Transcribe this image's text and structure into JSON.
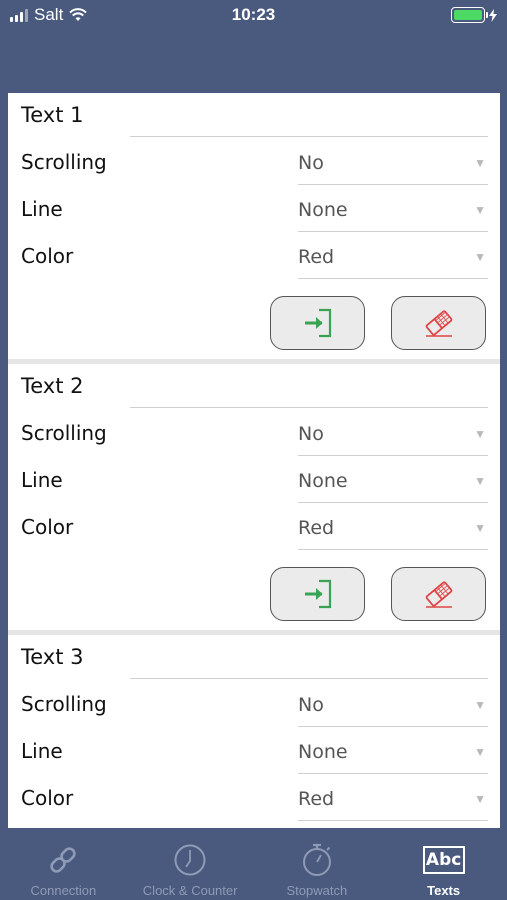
{
  "status": {
    "carrier": "Salt",
    "time": "10:23",
    "battery_color": "#4cd964"
  },
  "cards": [
    {
      "title": "Text 1",
      "rows": [
        {
          "label": "Scrolling",
          "value": "No"
        },
        {
          "label": "Line",
          "value": "None"
        },
        {
          "label": "Color",
          "value": "Red"
        }
      ]
    },
    {
      "title": "Text 2",
      "rows": [
        {
          "label": "Scrolling",
          "value": "No"
        },
        {
          "label": "Line",
          "value": "None"
        },
        {
          "label": "Color",
          "value": "Red"
        }
      ]
    },
    {
      "title": "Text 3",
      "rows": [
        {
          "label": "Scrolling",
          "value": "No"
        },
        {
          "label": "Line",
          "value": "None"
        },
        {
          "label": "Color",
          "value": "Red"
        }
      ]
    }
  ],
  "icons": {
    "load": "sign-in-icon",
    "clear": "eraser-icon",
    "load_color": "#3aa352",
    "clear_color": "#e04545"
  },
  "tabbar": {
    "tabs": [
      {
        "label": "Connection",
        "icon": "link-icon"
      },
      {
        "label": "Clock & Counter",
        "icon": "clock-icon"
      },
      {
        "label": "Stopwatch",
        "icon": "stopwatch-icon"
      },
      {
        "label": "Texts",
        "icon": "abc-icon",
        "icon_text": "Abc",
        "active": true
      }
    ]
  }
}
